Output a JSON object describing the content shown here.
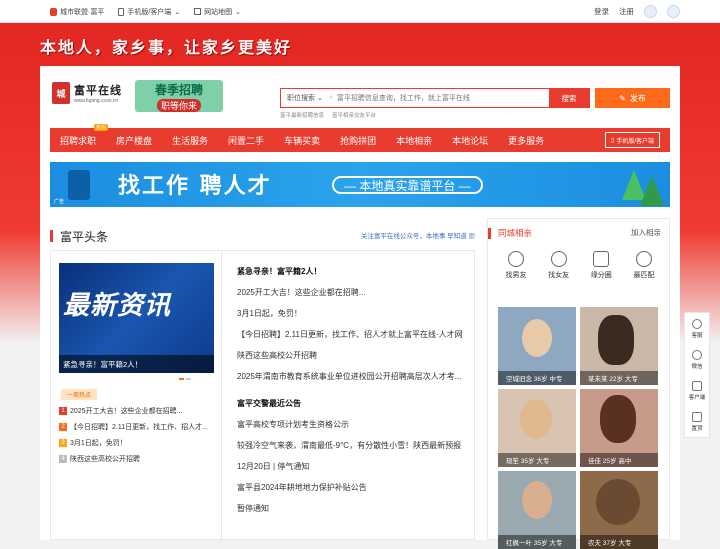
{
  "topbar": {
    "city": "城市联盟·富平",
    "mobile": "手机版/客户端",
    "sitemap": "网站地图",
    "login": "登录",
    "register": "注册"
  },
  "slogan": "本地人，家乡事，让家乡更美好",
  "logo": {
    "name": "富平在线",
    "url": "www.fuping.ccoo.cn",
    "mark": "城"
  },
  "promo": {
    "title": "春季招聘",
    "sub": "职等你来"
  },
  "search": {
    "category": "职位搜索",
    "placeholder": "富平招聘信息查询，找工作，就上富平在线",
    "button": "搜索",
    "hot": [
      "富平最新招聘信息",
      "富平相亲交友平台"
    ]
  },
  "post_button": "发布",
  "nav": {
    "items": [
      {
        "label": "招聘求职",
        "badge": "热招"
      },
      {
        "label": "房产楼盘",
        "badge": ""
      },
      {
        "label": "生活服务",
        "badge": ""
      },
      {
        "label": "闲置二手",
        "badge": ""
      },
      {
        "label": "车辆买卖",
        "badge": ""
      },
      {
        "label": "抢购拼团",
        "badge": ""
      },
      {
        "label": "本地相亲",
        "badge": ""
      },
      {
        "label": "本地论坛",
        "badge": ""
      },
      {
        "label": "更多服务",
        "badge": ""
      }
    ],
    "mobile": "手机版/客户端"
  },
  "ad": {
    "main": "找工作 聘人才",
    "sub": "— 本地真实靠谱平台 —",
    "tag": "广告"
  },
  "headlines": {
    "title": "富平头条",
    "more": "关注富平在线公众号，本地事 早知道"
  },
  "feature": {
    "image_text": "最新资讯",
    "caption": "紧急寻亲！富平籍2人！"
  },
  "hot_tag": "一周热点",
  "hot_list": [
    {
      "n": "1",
      "text": "2025开工大吉！这些企业都在招聘...",
      "color": "#e83c2e"
    },
    {
      "n": "2",
      "text": "【今日招聘】2.11日更新，找工作、招人才...",
      "color": "#ff6a1a"
    },
    {
      "n": "3",
      "text": "3月1日起，免罚！",
      "color": "#ffa41a"
    },
    {
      "n": "4",
      "text": "陕西这些高校公开招聘",
      "color": "#bbbbbb"
    }
  ],
  "news_list": [
    {
      "text": "紧急寻亲！富平籍2人！",
      "bold": true
    },
    {
      "text": "2025开工大吉！这些企业都在招聘...",
      "bold": false
    },
    {
      "text": "3月1日起，免罚！",
      "bold": false
    },
    {
      "text": "【今日招聘】2.11日更新，找工作、招人才就上富平在线·人才网",
      "bold": false
    },
    {
      "text": "陕西这些高校公开招聘",
      "bold": false
    },
    {
      "text": "2025年渭南市教育系统事业单位进校园公开招聘高层次人才考...",
      "bold": false
    },
    {
      "text": "富平交警最近公告",
      "bold": true
    },
    {
      "text": "富平高校专项计划考生资格公示",
      "bold": false
    },
    {
      "text": "较强冷空气来袭，渭南最低-9°C，有分散性小雪！陕西最新预报",
      "bold": false
    },
    {
      "text": "12月20日 | 停气通知",
      "bold": false
    },
    {
      "text": "富平县2024年耕地地力保护补贴公告",
      "bold": false
    },
    {
      "text": "暂停通知",
      "bold": false
    }
  ],
  "dating": {
    "title": "同城相亲",
    "more": "加入相亲",
    "icons": [
      {
        "label": "找男友",
        "icon": "male-icon"
      },
      {
        "label": "找女友",
        "icon": "female-icon"
      },
      {
        "label": "缘分圈",
        "icon": "circle-icon"
      },
      {
        "label": "最匹配",
        "icon": "target-icon"
      }
    ],
    "people": [
      {
        "caption": "空城旧念 36岁 中专",
        "bg": "#8fa8c2"
      },
      {
        "caption": "某未某 22岁 大专",
        "bg": "#c9b8a8"
      },
      {
        "caption": "现笙 35岁 大专",
        "bg": "#d8c4b0"
      },
      {
        "caption": "佳佳 25岁 高中",
        "bg": "#c89a8a"
      },
      {
        "caption": "红枫一叶 35岁 大专",
        "bg": "#9aa8b0"
      },
      {
        "caption": "农夫 37岁 大专",
        "bg": "#8c6a4a"
      }
    ]
  },
  "float_bar": [
    {
      "label": "客服",
      "icon": "service-icon"
    },
    {
      "label": "微信",
      "icon": "wechat-icon"
    },
    {
      "label": "客户端",
      "icon": "qrcode-icon"
    },
    {
      "label": "置顶",
      "icon": "top-icon"
    }
  ]
}
